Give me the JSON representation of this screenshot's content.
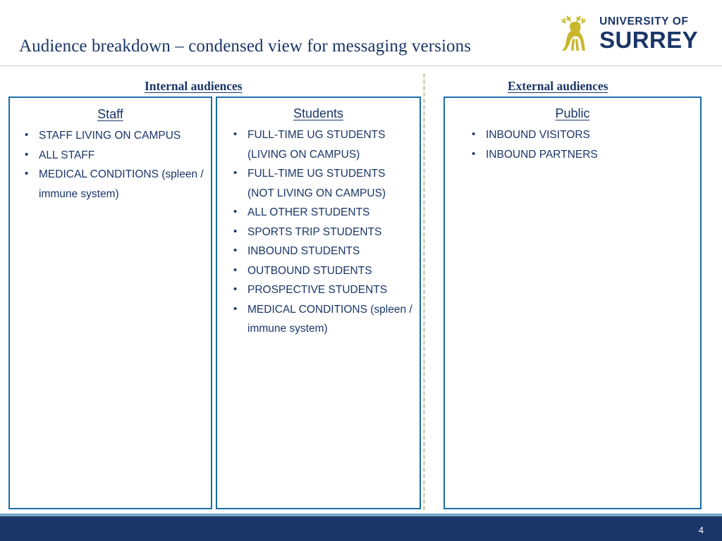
{
  "slide": {
    "title": "Audience breakdown – condensed view for messaging versions",
    "number": "4"
  },
  "logo": {
    "deer_icon": "deer-icon",
    "line1": "UNIVERSITY OF",
    "line2": "SURREY"
  },
  "sections": {
    "internal_heading": "Internal audiences",
    "external_heading": "External audiences"
  },
  "boxes": [
    {
      "id": "staff",
      "title": "Staff",
      "items": [
        "STAFF LIVING ON CAMPUS",
        "ALL STAFF",
        "MEDICAL CONDITIONS (spleen / immune system)"
      ]
    },
    {
      "id": "students",
      "title": "Students",
      "items": [
        "FULL-TIME UG STUDENTS (LIVING ON CAMPUS)",
        "FULL-TIME UG STUDENTS (NOT LIVING ON CAMPUS)",
        "ALL OTHER STUDENTS",
        "SPORTS TRIP STUDENTS",
        "INBOUND STUDENTS",
        "OUTBOUND STUDENTS",
        "PROSPECTIVE STUDENTS",
        "MEDICAL CONDITIONS (spleen / immune system)"
      ]
    },
    {
      "id": "public",
      "title": "Public",
      "items": [
        "INBOUND VISITORS",
        "INBOUND PARTNERS"
      ]
    }
  ],
  "colors": {
    "navy": "#1a3668",
    "box_border": "#1a6ea8",
    "logo_gold": "#c9b72a",
    "footer": "#1a3668",
    "footer_accent": "#7aa7c7",
    "divider": "#d6d2c4"
  }
}
